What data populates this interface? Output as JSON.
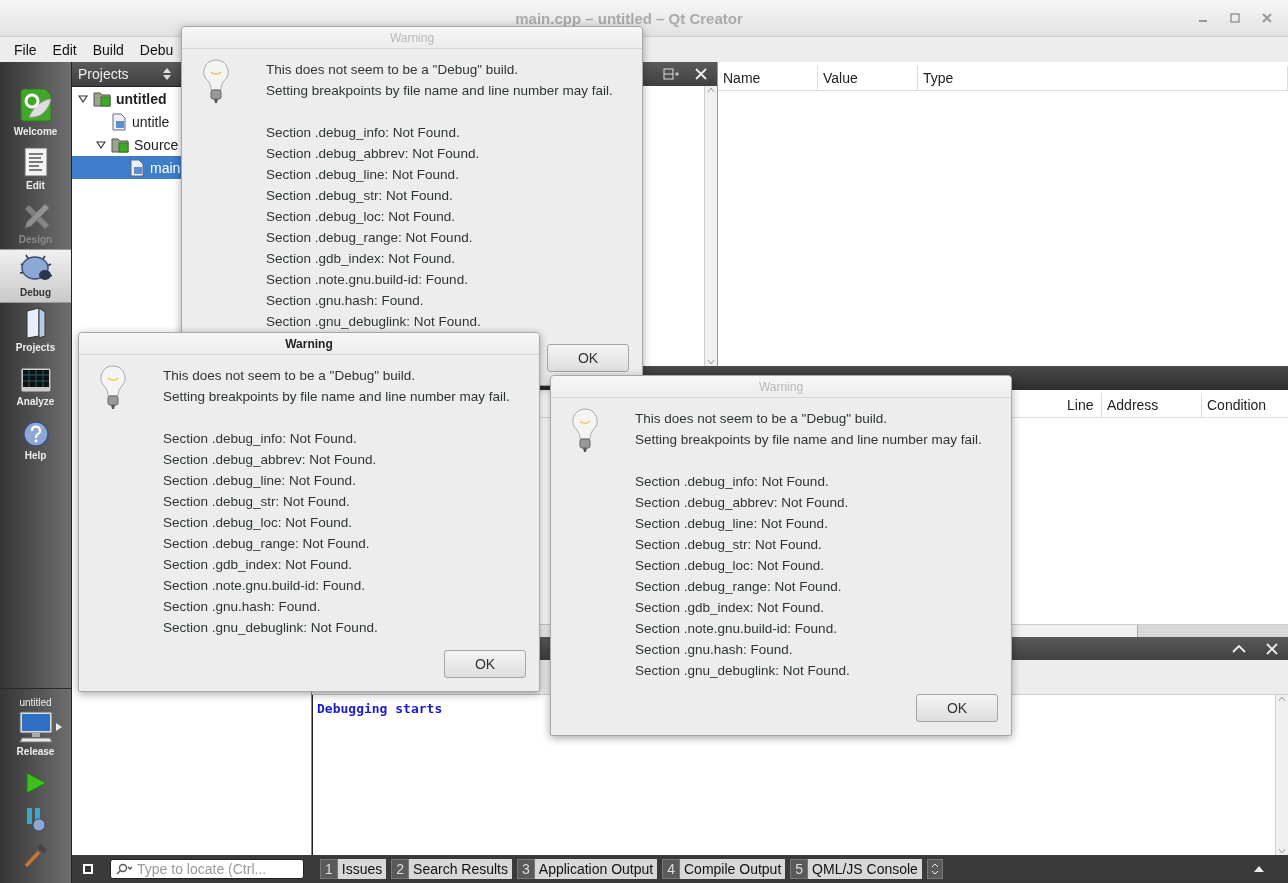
{
  "window": {
    "title": "main.cpp – untitled – Qt Creator"
  },
  "menu": [
    "File",
    "Edit",
    "Build",
    "Debu"
  ],
  "modes": [
    {
      "label": "Welcome",
      "selected": false,
      "disabled": false
    },
    {
      "label": "Edit",
      "selected": false,
      "disabled": false
    },
    {
      "label": "Design",
      "selected": false,
      "disabled": true
    },
    {
      "label": "Debug",
      "selected": true,
      "disabled": false
    },
    {
      "label": "Projects",
      "selected": false,
      "disabled": false
    },
    {
      "label": "Analyze",
      "selected": false,
      "disabled": false
    },
    {
      "label": "Help",
      "selected": false,
      "disabled": false
    }
  ],
  "target": {
    "project": "untitled",
    "configuration": "Release"
  },
  "projects_pane": {
    "title": "Projects",
    "tree": [
      {
        "label": "untitled",
        "expanded": true,
        "selected": false,
        "children": [
          {
            "label": "untitle",
            "selected": false
          },
          {
            "label": "Source",
            "expanded": true,
            "selected": false,
            "children": [
              {
                "label": "main",
                "selected": true
              }
            ]
          }
        ]
      }
    ]
  },
  "locals": {
    "columns": [
      "Name",
      "Value",
      "Type"
    ]
  },
  "breakpoints": {
    "columns": [
      "Line",
      "Address",
      "Condition"
    ]
  },
  "output": {
    "lines": [
      "Debugging starts"
    ]
  },
  "locator": {
    "placeholder": "Type to locate (Ctrl..."
  },
  "output_tabs": [
    {
      "number": "1",
      "label": "Issues"
    },
    {
      "number": "2",
      "label": "Search Results"
    },
    {
      "number": "3",
      "label": "Application Output"
    },
    {
      "number": "4",
      "label": "Compile Output"
    },
    {
      "number": "5",
      "label": "QML/JS Console"
    }
  ],
  "dialogs": [
    {
      "title": "Warning",
      "active": false,
      "intro": [
        "This does not seem to be a \"Debug\" build.",
        "Setting breakpoints by file name and line number may fail."
      ],
      "sections": [
        "Section .debug_info: Not Found.",
        "Section .debug_abbrev: Not Found.",
        "Section .debug_line: Not Found.",
        "Section .debug_str: Not Found.",
        "Section .debug_loc: Not Found.",
        "Section .debug_range: Not Found.",
        "Section .gdb_index: Not Found.",
        "Section .note.gnu.build-id: Found.",
        "Section .gnu.hash: Found.",
        "Section .gnu_debuglink: Not Found."
      ],
      "button": "OK"
    },
    {
      "title": "Warning",
      "active": true,
      "intro": [
        "This does not seem to be a \"Debug\" build.",
        "Setting breakpoints by file name and line number may fail."
      ],
      "sections": [
        "Section .debug_info: Not Found.",
        "Section .debug_abbrev: Not Found.",
        "Section .debug_line: Not Found.",
        "Section .debug_str: Not Found.",
        "Section .debug_loc: Not Found.",
        "Section .debug_range: Not Found.",
        "Section .gdb_index: Not Found.",
        "Section .note.gnu.build-id: Found.",
        "Section .gnu.hash: Found.",
        "Section .gnu_debuglink: Not Found."
      ],
      "button": "OK"
    },
    {
      "title": "Warning",
      "active": false,
      "intro": [
        "This does not seem to be a \"Debug\" build.",
        "Setting breakpoints by file name and line number may fail."
      ],
      "sections": [
        "Section .debug_info: Not Found.",
        "Section .debug_abbrev: Not Found.",
        "Section .debug_line: Not Found.",
        "Section .debug_str: Not Found.",
        "Section .debug_loc: Not Found.",
        "Section .debug_range: Not Found.",
        "Section .gdb_index: Not Found.",
        "Section .note.gnu.build-id: Found.",
        "Section .gnu.hash: Found.",
        "Section .gnu_debuglink: Not Found."
      ],
      "button": "OK"
    }
  ]
}
